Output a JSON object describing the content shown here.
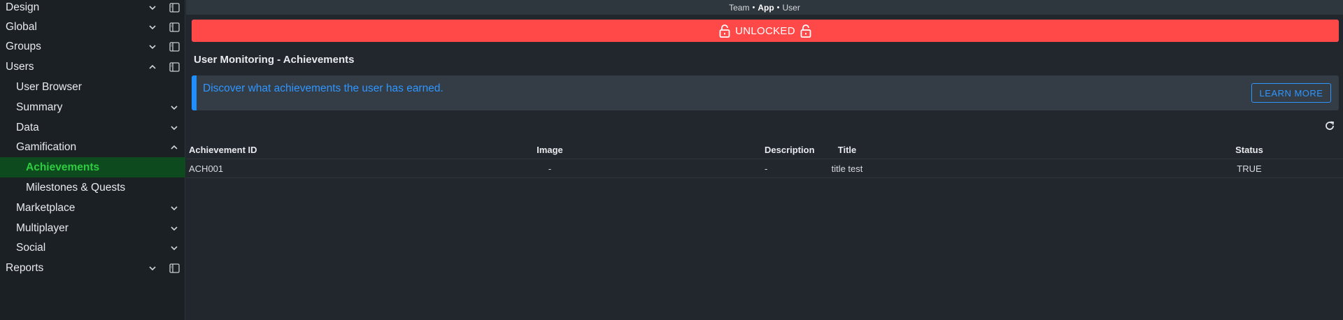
{
  "sidebar": {
    "items": [
      {
        "label": "Design",
        "chevron": "down",
        "panel": true
      },
      {
        "label": "Global",
        "chevron": "down",
        "panel": true
      },
      {
        "label": "Groups",
        "chevron": "down",
        "panel": true
      },
      {
        "label": "Users",
        "chevron": "up",
        "panel": true
      },
      {
        "label": "User Browser"
      },
      {
        "label": "Summary",
        "chevron": "down"
      },
      {
        "label": "Data",
        "chevron": "down"
      },
      {
        "label": "Gamification",
        "chevron": "up"
      },
      {
        "label": "Achievements",
        "active": true
      },
      {
        "label": "Milestones & Quests"
      },
      {
        "label": "Marketplace",
        "chevron": "down"
      },
      {
        "label": "Multiplayer",
        "chevron": "down"
      },
      {
        "label": "Social",
        "chevron": "down"
      },
      {
        "label": "Reports",
        "chevron": "down",
        "panel": true
      }
    ]
  },
  "breadcrumb": {
    "team": "Team",
    "app": "App",
    "user": "User",
    "separator": "•"
  },
  "banner": {
    "label": "UNLOCKED",
    "color": "#ff4848"
  },
  "page": {
    "title": "User Monitoring - Achievements"
  },
  "info": {
    "text": "Discover what achievements the user has earned.",
    "button_label": "LEARN MORE",
    "accent": "#1e90ff"
  },
  "table": {
    "headers": {
      "id": "Achievement ID",
      "image": "Image",
      "title": "Title",
      "description": "Description",
      "status": "Status"
    },
    "rows": [
      {
        "id": "ACH001",
        "image": "-",
        "title": "title test",
        "description": "-",
        "status": "TRUE"
      }
    ]
  },
  "colors": {
    "active_text": "#2ecc40",
    "active_bg": "#0d4a1e"
  }
}
